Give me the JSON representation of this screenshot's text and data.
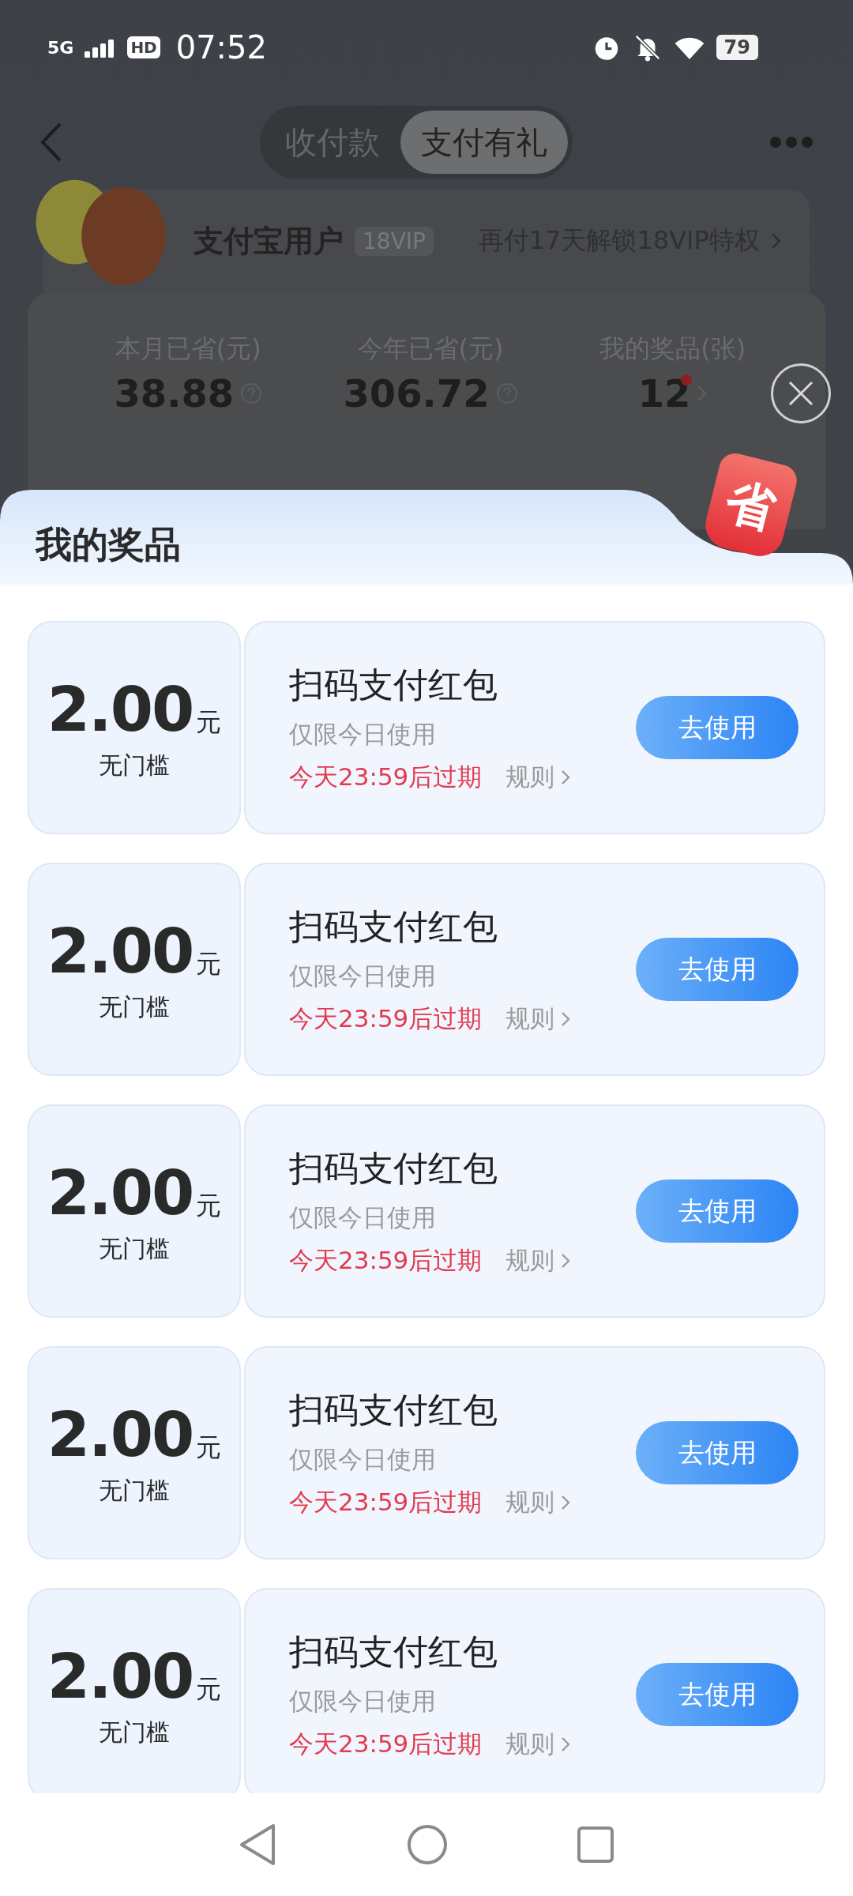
{
  "status_bar": {
    "network": "5G",
    "hd": "HD",
    "time": "07:52",
    "battery": "79"
  },
  "header": {
    "tabs": [
      {
        "label": "收付款",
        "selected": false
      },
      {
        "label": "支付有礼",
        "selected": true
      }
    ]
  },
  "user_card": {
    "name": "支付宝用户",
    "badge": "18VIP",
    "promo": "再付17天解锁18VIP特权"
  },
  "stats": [
    {
      "label": "本月已省(元)",
      "value": "38.88",
      "kind": "help",
      "unread": false
    },
    {
      "label": "今年已省(元)",
      "value": "306.72",
      "kind": "help",
      "unread": false
    },
    {
      "label": "我的奖品(张)",
      "value": "12",
      "kind": "link",
      "unread": true
    }
  ],
  "sheet": {
    "title": "我的奖品",
    "tag": "省",
    "coupons": [
      {
        "amount": "2.00",
        "unit": "元",
        "condition": "无门槛",
        "title": "扫码支付红包",
        "note": "仅限今日使用",
        "expiry": "今天23:59后过期",
        "rules": "规则",
        "action": "去使用"
      },
      {
        "amount": "2.00",
        "unit": "元",
        "condition": "无门槛",
        "title": "扫码支付红包",
        "note": "仅限今日使用",
        "expiry": "今天23:59后过期",
        "rules": "规则",
        "action": "去使用"
      },
      {
        "amount": "2.00",
        "unit": "元",
        "condition": "无门槛",
        "title": "扫码支付红包",
        "note": "仅限今日使用",
        "expiry": "今天23:59后过期",
        "rules": "规则",
        "action": "去使用"
      },
      {
        "amount": "2.00",
        "unit": "元",
        "condition": "无门槛",
        "title": "扫码支付红包",
        "note": "仅限今日使用",
        "expiry": "今天23:59后过期",
        "rules": "规则",
        "action": "去使用"
      },
      {
        "amount": "2.00",
        "unit": "元",
        "condition": "无门槛",
        "title": "扫码支付红包",
        "note": "仅限今日使用",
        "expiry": "今天23:59后过期",
        "rules": "规则",
        "action": "去使用"
      }
    ]
  }
}
